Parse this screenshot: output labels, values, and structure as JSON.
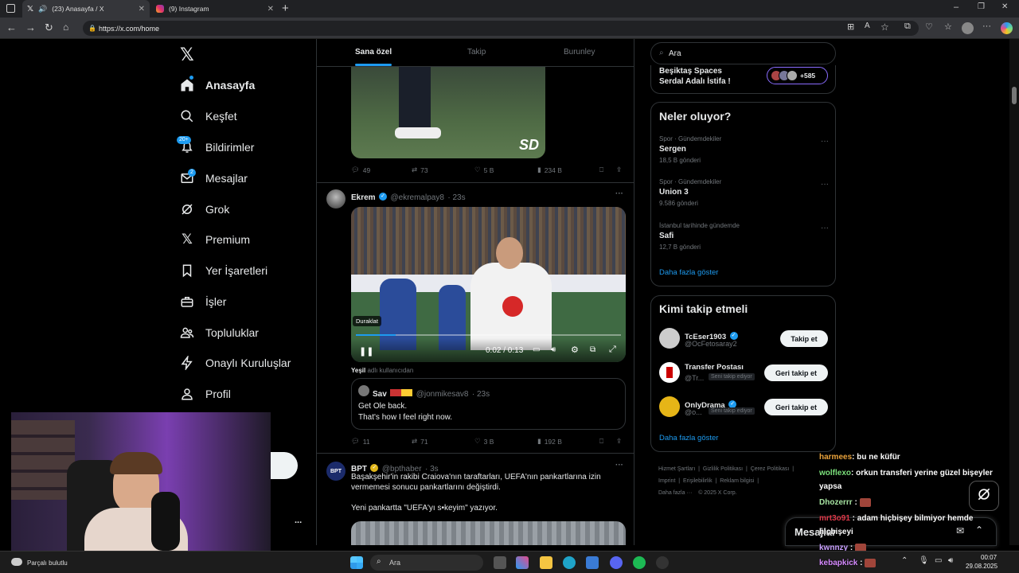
{
  "browser": {
    "tabs": [
      {
        "title": "(23) Anasayfa / X",
        "active": true
      },
      {
        "title": "(9) Instagram",
        "active": false
      }
    ],
    "new_tab": "+",
    "url": "https://x.com/home",
    "window_controls": [
      "–",
      "❐",
      "✕"
    ]
  },
  "nav": {
    "items": [
      {
        "label": "Anasayfa",
        "icon": "home-icon"
      },
      {
        "label": "Keşfet",
        "icon": "search-icon"
      },
      {
        "label": "Bildirimler",
        "icon": "bell-icon",
        "badge": "20+"
      },
      {
        "label": "Mesajlar",
        "icon": "mail-icon",
        "badge": "2"
      },
      {
        "label": "Grok",
        "icon": "grok-icon"
      },
      {
        "label": "Premium",
        "icon": "x-icon"
      },
      {
        "label": "Yer İşaretleri",
        "icon": "bookmark-icon"
      },
      {
        "label": "İşler",
        "icon": "briefcase-icon"
      },
      {
        "label": "Topluluklar",
        "icon": "people-icon"
      },
      {
        "label": "Onaylı Kuruluşlar",
        "icon": "lightning-icon"
      },
      {
        "label": "Profil",
        "icon": "person-icon"
      }
    ],
    "more": "..."
  },
  "feed": {
    "tabs": [
      "Sana özel",
      "Takip",
      "Burunley"
    ],
    "tweet1": {
      "watermark": "SD",
      "replies": "49",
      "retweets": "73",
      "likes": "5 B",
      "views": "234 B"
    },
    "tweet2": {
      "name": "Ekrem",
      "handle": "@ekremalpay8",
      "time": "· 23s",
      "more": "···",
      "video": {
        "tooltip": "Duraklat",
        "time": "0:02 / 0:13"
      },
      "posted_by_name": "Yeşil",
      "posted_by_rest": "adlı kullanıcıdan",
      "quote": {
        "name": "Sav",
        "handle": "@jonmikesav8",
        "time": "· 23s",
        "line1": "Get Ole back.",
        "line2": "That's how I feel right now."
      },
      "replies": "11",
      "retweets": "71",
      "likes": "3 B",
      "views": "192 B"
    },
    "tweet3": {
      "name": "BPT",
      "handle": "@bpthaber",
      "time": "· 3s",
      "more": "···",
      "avatar_text": "BPT",
      "line1": "Başakşehir'in rakibi Craiova'nın taraftarları, UEFA'nın pankartlarına izin",
      "line2": "vermemesi sonucu pankartlarını değiştirdi.",
      "line3": "Yeni pankartta \"UEFA'yı s•keyim\" yazıyor."
    }
  },
  "right": {
    "search_placeholder": "Ara",
    "spaces": {
      "line1": "Beşiktaş Spaces",
      "line2": "Serdal Adalı İstifa !",
      "count": "+585"
    },
    "trends": {
      "title": "Neler oluyor?",
      "items": [
        {
          "cat": "Spor · Gündemdekiler",
          "name": "Sergen",
          "count": "18,5 B gönderi"
        },
        {
          "cat": "Spor · Gündemdekiler",
          "name": "Union 3",
          "count": "9.586 gönderi"
        },
        {
          "cat": "İstanbul tarihinde gündemde",
          "name": "Safi",
          "count": "12,7 B gönderi"
        }
      ],
      "more": "Daha fazla göster"
    },
    "follow": {
      "title": "Kimi takip etmeli",
      "items": [
        {
          "name": "TcEser1903",
          "handle": "@OcFetosaray2",
          "button": "Takip et",
          "tag": ""
        },
        {
          "name": "Transfer Postası",
          "handle": "@Tr...",
          "button": "Geri takip et",
          "tag": "Seni takip ediyor"
        },
        {
          "name": "OnlyDrama",
          "handle": "@o...",
          "button": "Geri takip et",
          "tag": "Seni takip ediyor"
        }
      ],
      "more": "Daha fazla göster"
    },
    "footer": [
      "Hizmet Şartları",
      "Gizlilik Politikası",
      "Çerez Politikası",
      "Imprint",
      "Erişilebilirlik",
      "Reklam bilgisi",
      "Daha fazla ···",
      "© 2025 X Corp."
    ]
  },
  "messages_dock": {
    "label": "Mesajlar"
  },
  "chat": [
    {
      "user": "harmees",
      "color": "#e9a23b",
      "text": ": bu ne küfür"
    },
    {
      "user": "wolflexo",
      "color": "#7be07b",
      "text": ": orkun transferi yerine güzel bişeyler"
    },
    {
      "user": "",
      "color": "#ffffff",
      "text": "yapsa"
    },
    {
      "user": "Dhozerrr",
      "color": "#a6e3a1",
      "text": " :"
    },
    {
      "user": "mrt3o91",
      "color": "#e03a4a",
      "text": " : adam hiçbişey bilmiyor hemde"
    },
    {
      "user": "",
      "color": "#ffffff",
      "text": "hiçbişeyi"
    },
    {
      "user": "kwnnzy",
      "color": "#c9a0ff",
      "text": " :"
    },
    {
      "user": "kebapkick",
      "color": "#d68bff",
      "text": " :"
    }
  ],
  "taskbar": {
    "weather": "Parçalı bulutlu",
    "search": "Ara",
    "time": "00:07",
    "date": "29.08.2025"
  }
}
